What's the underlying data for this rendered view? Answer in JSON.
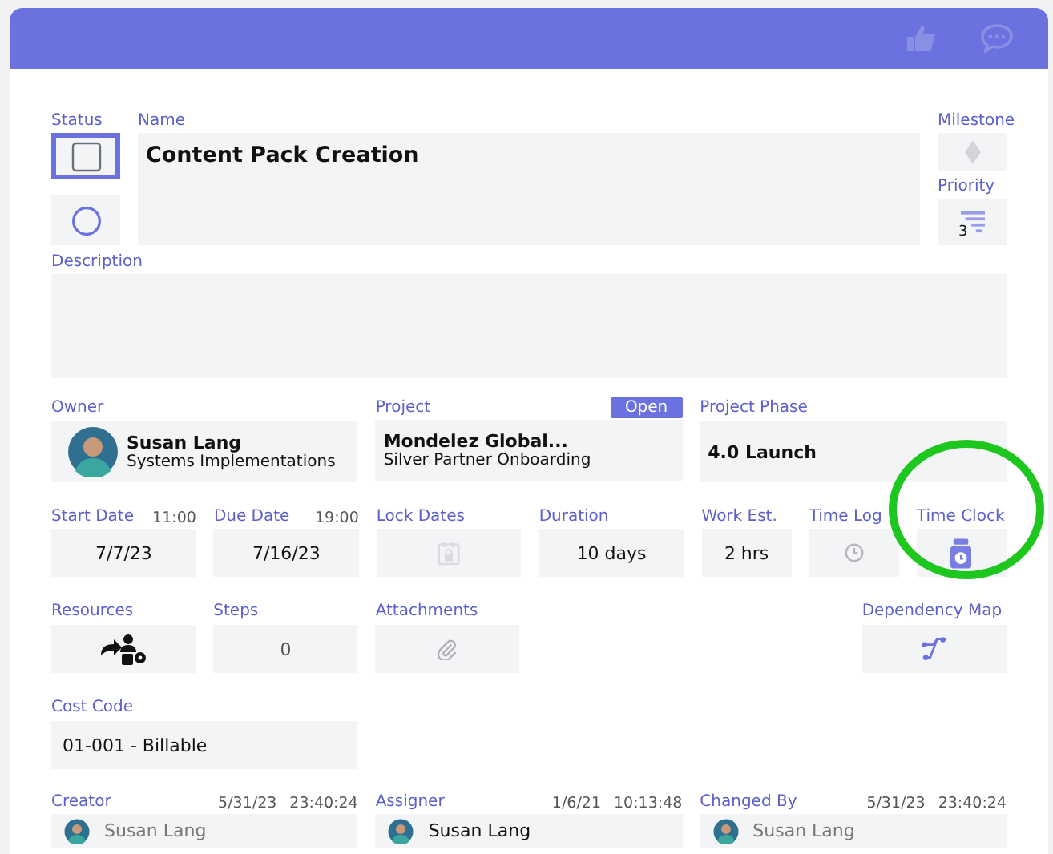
{
  "status": {
    "label": "Status",
    "checked": false
  },
  "name": {
    "label": "Name",
    "value": "Content Pack Creation"
  },
  "milestone": {
    "label": "Milestone"
  },
  "priority": {
    "label": "Priority",
    "value": "3"
  },
  "description": {
    "label": "Description"
  },
  "owner": {
    "label": "Owner",
    "name": "Susan Lang",
    "team": "Systems Implementations"
  },
  "project": {
    "label": "Project",
    "badge": "Open",
    "name": "Mondelez Global...",
    "subtitle": "Silver Partner Onboarding"
  },
  "project_phase": {
    "label": "Project Phase",
    "value": "4.0 Launch"
  },
  "schedule": [
    {
      "kind": "text",
      "label": "Start Date",
      "time": "11:00",
      "value": "7/7/23"
    },
    {
      "kind": "text",
      "label": "Due Date",
      "time": "19:00",
      "value": "7/16/23"
    },
    {
      "kind": "lock",
      "label": "Lock Dates"
    },
    {
      "kind": "text",
      "label": "Duration",
      "value": "10 days"
    },
    {
      "kind": "text",
      "label": "Work Est.",
      "value": "2 hrs"
    },
    {
      "kind": "log",
      "label": "Time Log"
    },
    {
      "kind": "clock",
      "label": "Time Clock"
    }
  ],
  "resources": {
    "label": "Resources"
  },
  "steps": {
    "label": "Steps",
    "value": "0"
  },
  "attachments": {
    "label": "Attachments"
  },
  "dependency_map": {
    "label": "Dependency Map"
  },
  "cost_code": {
    "label": "Cost Code",
    "value": "01-001 - Billable"
  },
  "audit": [
    {
      "label": "Creator",
      "date": "5/31/23",
      "time": "23:40:24",
      "user": "Susan Lang",
      "disabled": true
    },
    {
      "label": "Assigner",
      "date": "1/6/21",
      "time": "10:13:48",
      "user": "Susan Lang",
      "disabled": false
    },
    {
      "label": "Changed By",
      "date": "5/31/23",
      "time": "23:40:24",
      "user": "Susan Lang",
      "disabled": true
    }
  ]
}
